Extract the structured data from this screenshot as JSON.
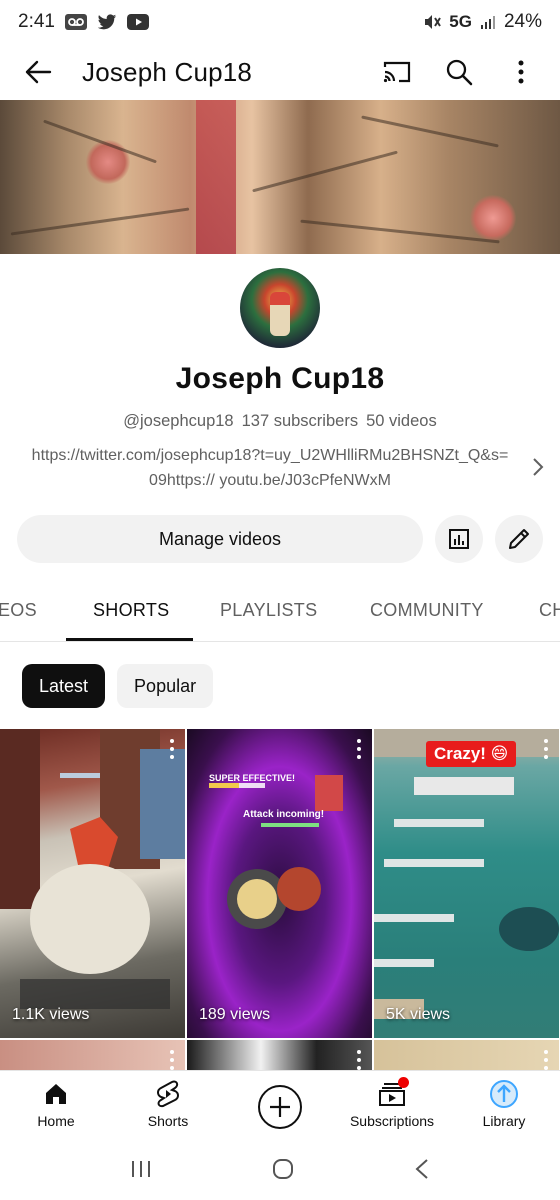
{
  "status_bar": {
    "time": "2:41",
    "network": "5G",
    "battery": "24%",
    "icons": [
      "voicemail-icon",
      "twitter-icon",
      "youtube-icon",
      "mute-icon",
      "signal-icon"
    ]
  },
  "app_bar": {
    "title": "Joseph Cup18",
    "actions": [
      "cast-icon",
      "search-icon",
      "more-vert-icon"
    ]
  },
  "channel": {
    "name": "Joseph Cup18",
    "handle": "@josephcup18",
    "subscribers": "137 subscribers",
    "videos": "50 videos",
    "links_line1": "https://twitter.com/josephcup18?t=uy_U2WHlliRMu2BHSNZt_Q&s=",
    "links_line2": "09https:// youtu.be/J03cPfeNWxM"
  },
  "manage": {
    "label": "Manage videos",
    "icons": [
      "analytics-icon",
      "edit-pencil-icon"
    ]
  },
  "tabs": [
    {
      "label": "EOS",
      "active": false
    },
    {
      "label": "SHORTS",
      "active": true
    },
    {
      "label": "PLAYLISTS",
      "active": false
    },
    {
      "label": "COMMUNITY",
      "active": false
    },
    {
      "label": "CH",
      "active": false
    }
  ],
  "chips": [
    {
      "label": "Latest",
      "selected": true
    },
    {
      "label": "Popular",
      "selected": false
    }
  ],
  "shorts": [
    {
      "views": "1.1K views"
    },
    {
      "views": "189 views",
      "overlay_top": "SUPER EFFECTIVE!",
      "overlay_mid": "Attack incoming!"
    },
    {
      "views": "5K views",
      "badge": "Crazy! 😄"
    }
  ],
  "bottom_nav": [
    {
      "label": "Home",
      "icon": "home-icon"
    },
    {
      "label": "Shorts",
      "icon": "shorts-icon"
    },
    {
      "label": "",
      "icon": "create-plus-icon"
    },
    {
      "label": "Subscriptions",
      "icon": "subscriptions-icon"
    },
    {
      "label": "Library",
      "icon": "library-icon"
    }
  ],
  "colors": {
    "text_primary": "#0f0f0f",
    "text_secondary": "#606060",
    "chip_bg": "#f2f2f2",
    "notification_dot": "#ee0000",
    "library_accent": "#3ea6ff"
  }
}
